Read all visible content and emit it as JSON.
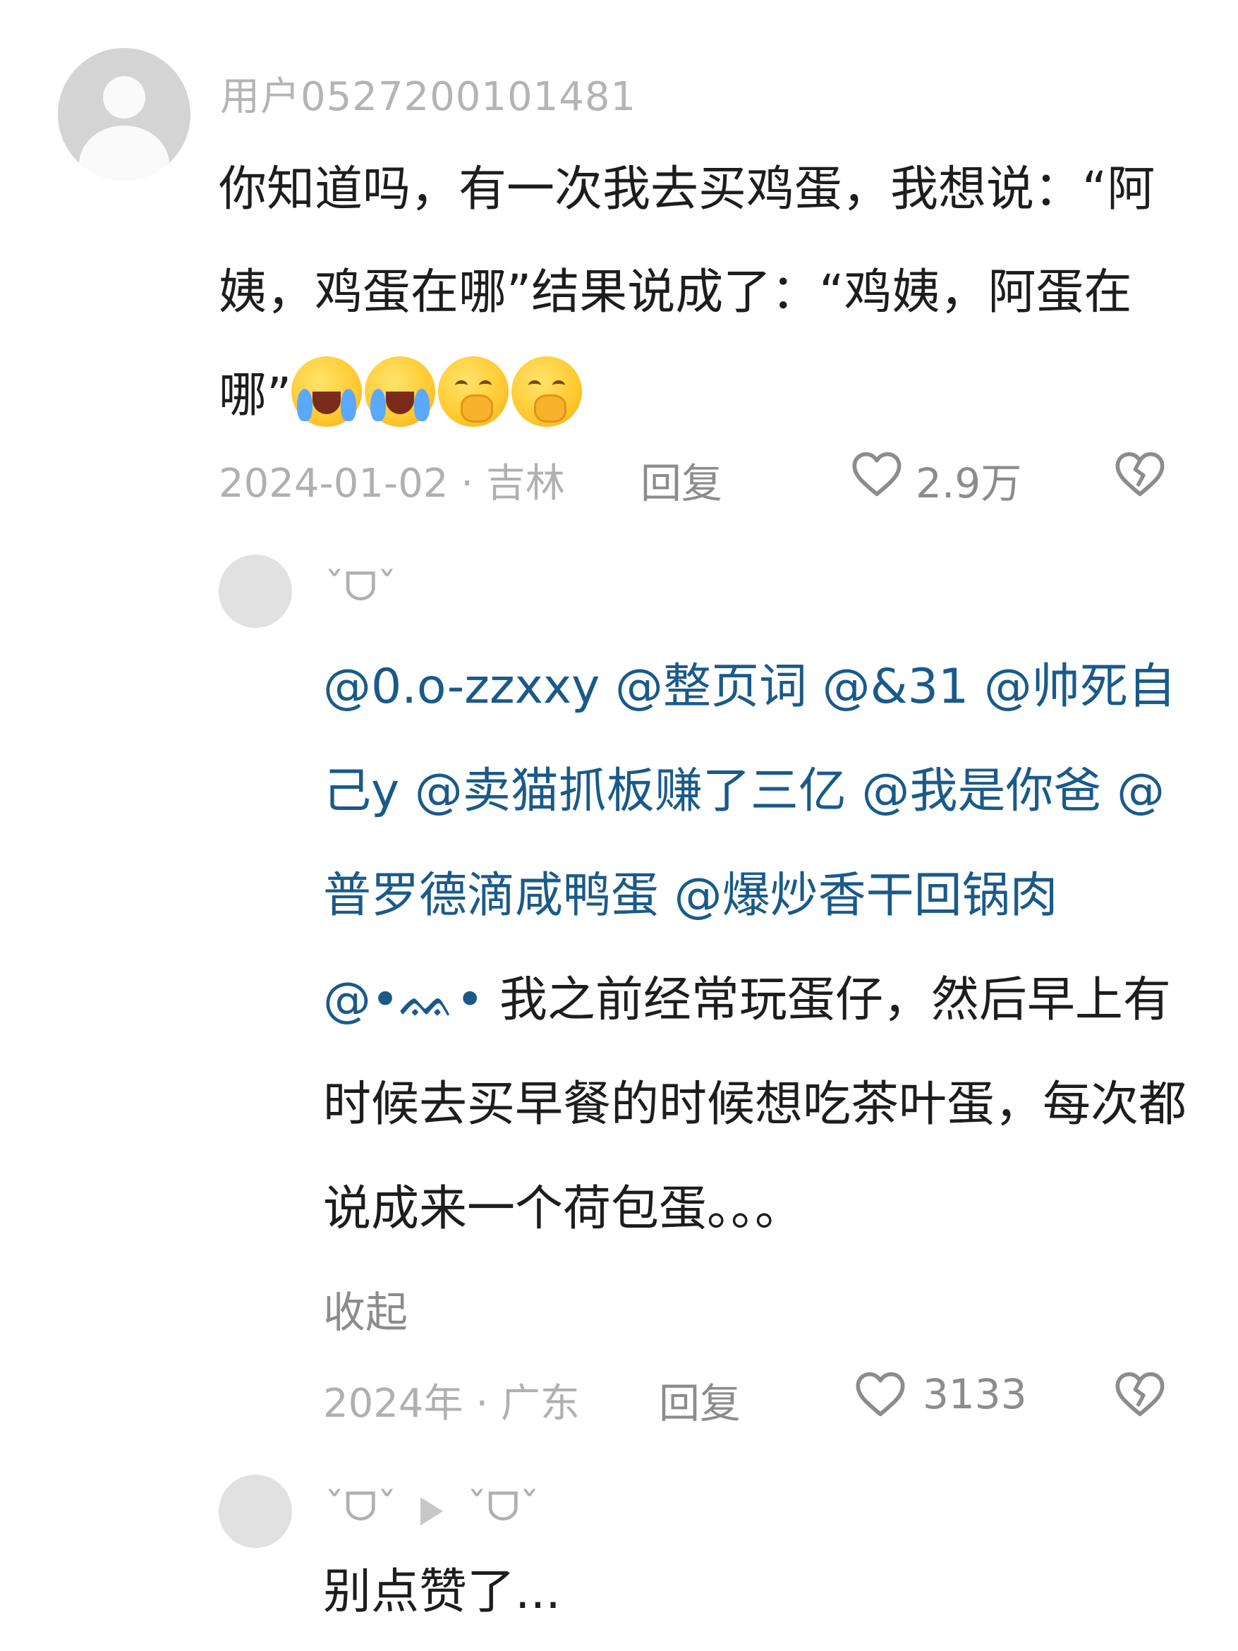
{
  "comment": {
    "username": "用户0527200101481",
    "text": "你知道吗，有一次我去买鸡蛋，我想说：“阿姨，鸡蛋在哪”结果说成了：“鸡姨，阿蛋在哪”",
    "emojis": [
      "face-with-tears-of-joy",
      "face-with-tears-of-joy",
      "face-with-hand-over-mouth",
      "face-with-hand-over-mouth"
    ],
    "date_location": "2024-01-02 · 吉林",
    "reply_label": "回复",
    "like_count": "2.9万"
  },
  "replies": [
    {
      "username": "ˇᗜˇ",
      "mentions": [
        "@0.o-zzxxy",
        "@整页词",
        "@&31",
        "@帅死自己y",
        "@卖猫抓板赚了三亿",
        "@我是你爸",
        "@普罗德滴咸鸭蛋",
        "@爆炒香干回锅肉",
        "@•ᨐ•"
      ],
      "text": "我之前经常玩蛋仔，然后早上有时候去买早餐的时候想吃茶叶蛋，每次都说成来一个荷包蛋。。。",
      "collapse_label": "收起",
      "date_location": "2024年 · 广东",
      "reply_label": "回复",
      "like_count": "3133"
    },
    {
      "username": "ˇᗜˇ",
      "reply_to": "ˇᗜˇ",
      "text": "别点赞了..."
    }
  ],
  "colors": {
    "mention": "#1a5a8a",
    "meta": "#b0b0b0",
    "action": "#8c8c8c"
  }
}
